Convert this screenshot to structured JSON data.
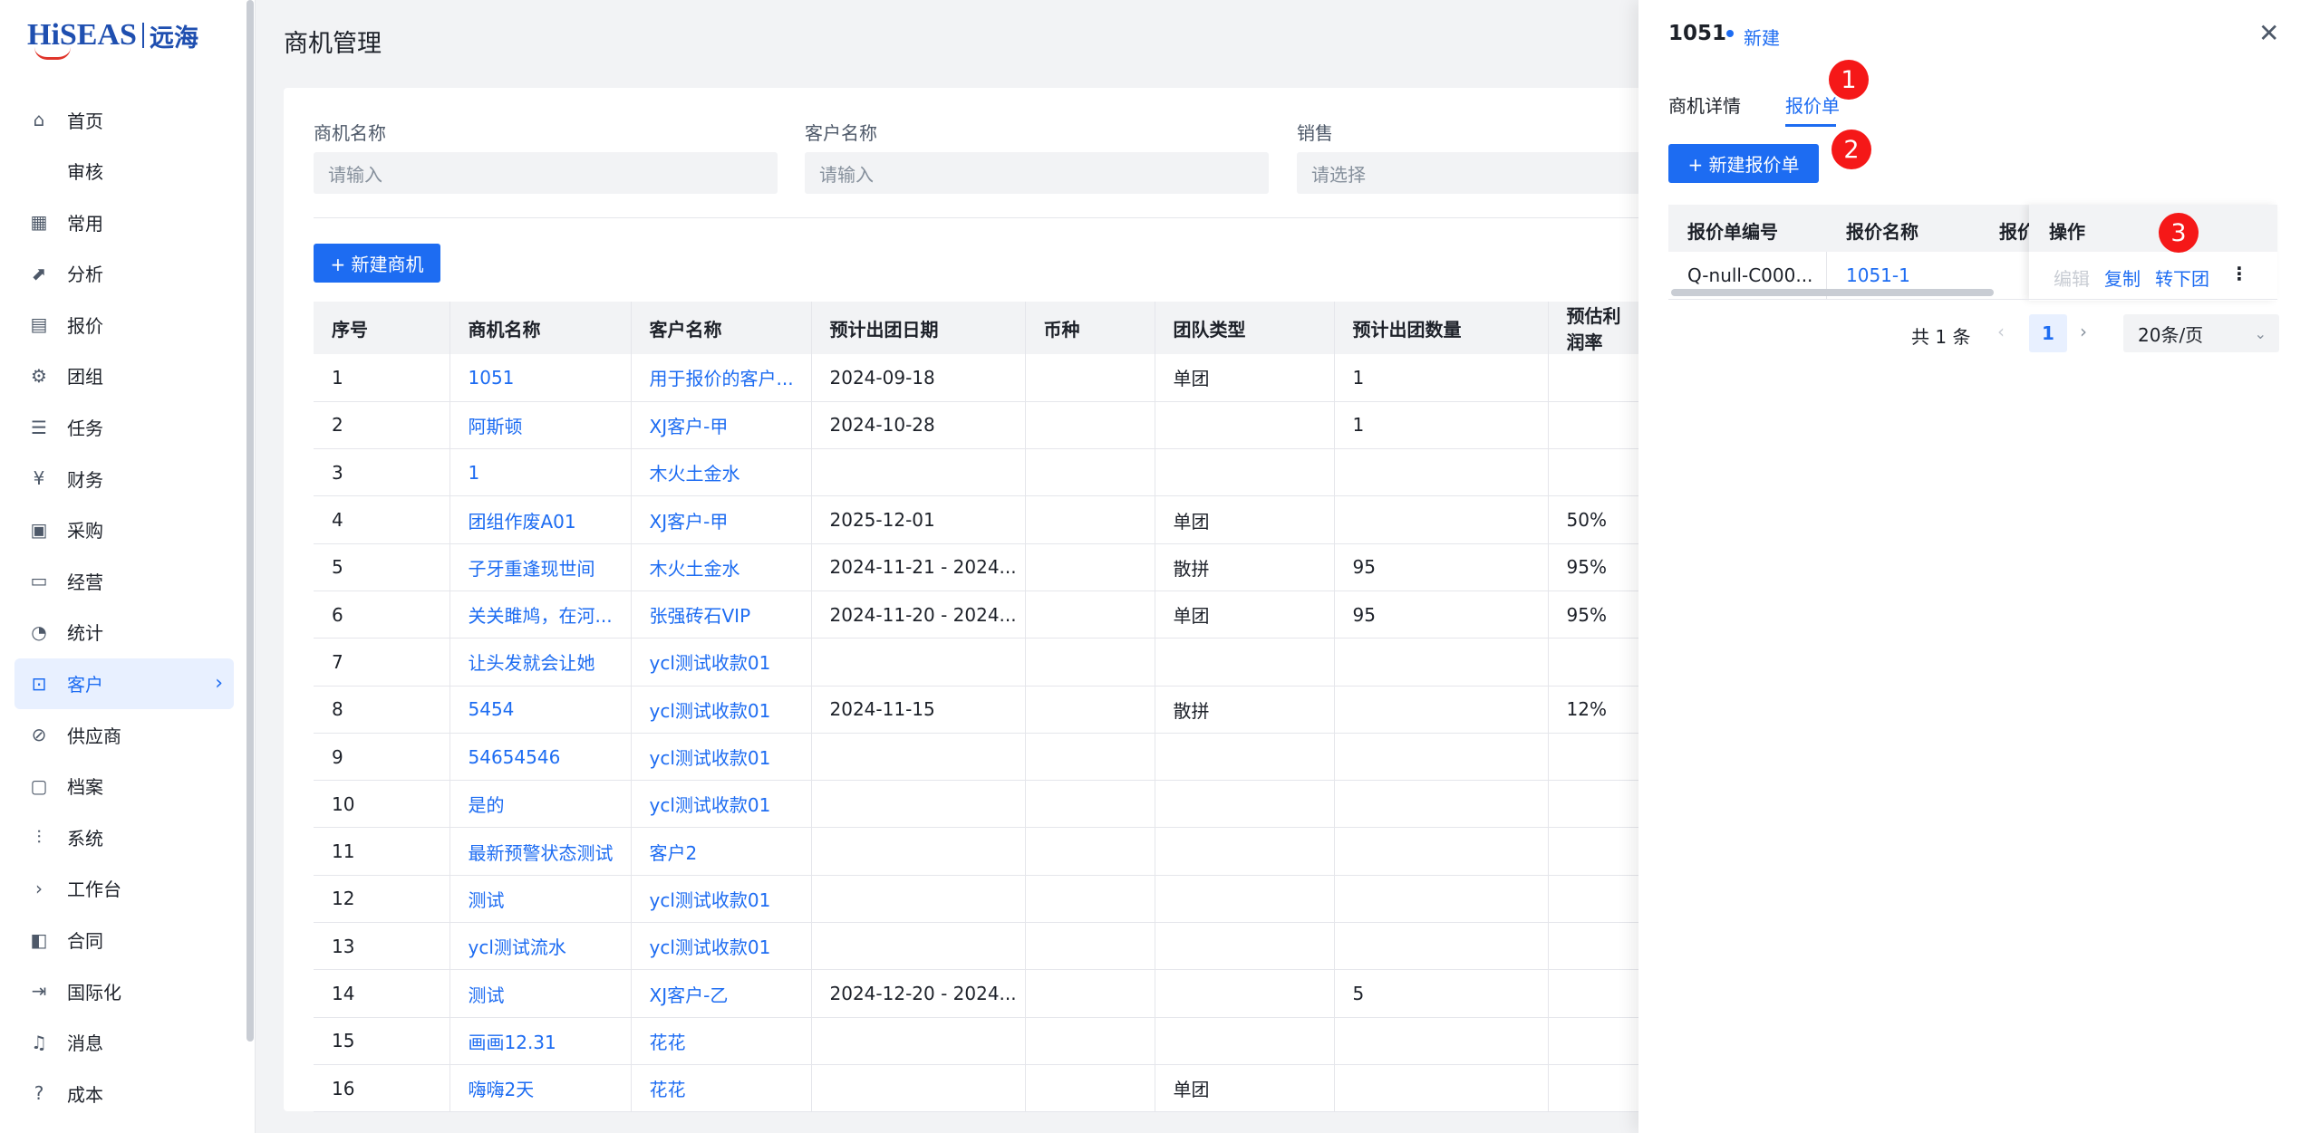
{
  "logo": {
    "brand": "HiSEAS",
    "cn": "远海"
  },
  "sidebar": {
    "items": [
      {
        "label": "首页",
        "icon": "home-icon"
      },
      {
        "label": "审核",
        "icon": ""
      },
      {
        "label": "常用",
        "icon": "grid-icon"
      },
      {
        "label": "分析",
        "icon": "chart-icon"
      },
      {
        "label": "报价",
        "icon": "document-icon"
      },
      {
        "label": "团组",
        "icon": "group-icon"
      },
      {
        "label": "任务",
        "icon": "task-icon"
      },
      {
        "label": "财务",
        "icon": "yen-icon"
      },
      {
        "label": "采购",
        "icon": "cart-icon"
      },
      {
        "label": "经营",
        "icon": "monitor-icon"
      },
      {
        "label": "统计",
        "icon": "pie-icon"
      },
      {
        "label": "客户",
        "icon": "customer-icon"
      },
      {
        "label": "供应商",
        "icon": "supplier-icon"
      },
      {
        "label": "档案",
        "icon": "folder-icon"
      },
      {
        "label": "系统",
        "icon": "settings-icon"
      },
      {
        "label": "工作台",
        "icon": "chevron-right-icon"
      },
      {
        "label": "合同",
        "icon": "contract-icon"
      },
      {
        "label": "国际化",
        "icon": "export-icon"
      },
      {
        "label": "消息",
        "icon": "bell-icon"
      },
      {
        "label": "成本",
        "icon": "cost-icon"
      }
    ],
    "active_index": 11
  },
  "page": {
    "title": "商机管理"
  },
  "filters": {
    "opportunity_name": {
      "label": "商机名称",
      "placeholder": "请输入"
    },
    "customer_name": {
      "label": "客户名称",
      "placeholder": "请输入"
    },
    "sales": {
      "label": "销售",
      "placeholder": "请选择"
    }
  },
  "toolbar": {
    "new_opportunity": "+ 新建商机"
  },
  "table": {
    "headers": [
      "序号",
      "商机名称",
      "客户名称",
      "预计出团日期",
      "币种",
      "团队类型",
      "预计出团数量",
      "预估利润率"
    ],
    "rows": [
      [
        "1",
        "1051",
        "用于报价的客户...",
        "2024-09-18",
        "",
        "单团",
        "1",
        ""
      ],
      [
        "2",
        "阿斯顿",
        "XJ客户-甲",
        "2024-10-28",
        "",
        "",
        "1",
        ""
      ],
      [
        "3",
        "1",
        "木火土金水",
        "",
        "",
        "",
        "",
        ""
      ],
      [
        "4",
        "团组作废A01",
        "XJ客户-甲",
        "2025-12-01",
        "",
        "单团",
        "",
        "50%"
      ],
      [
        "5",
        "子牙重逢现世间",
        "木火土金水",
        "2024-11-21 - 2024...",
        "",
        "散拼",
        "95",
        "95%"
      ],
      [
        "6",
        "关关雎鸠，在河...",
        "张强砖石VIP",
        "2024-11-20 - 2024...",
        "",
        "单团",
        "95",
        "95%"
      ],
      [
        "7",
        "让头发就会让她",
        "ycl测试收款01",
        "",
        "",
        "",
        "",
        ""
      ],
      [
        "8",
        "5454",
        "ycl测试收款01",
        "2024-11-15",
        "",
        "散拼",
        "",
        "12%"
      ],
      [
        "9",
        "54654546",
        "ycl测试收款01",
        "",
        "",
        "",
        "",
        ""
      ],
      [
        "10",
        "是的",
        "ycl测试收款01",
        "",
        "",
        "",
        "",
        ""
      ],
      [
        "11",
        "最新预警状态测试",
        "客户2",
        "",
        "",
        "",
        "",
        ""
      ],
      [
        "12",
        "测试",
        "ycl测试收款01",
        "",
        "",
        "",
        "",
        ""
      ],
      [
        "13",
        "ycl测试流水",
        "ycl测试收款01",
        "",
        "",
        "",
        "",
        ""
      ],
      [
        "14",
        "测试",
        "XJ客户-乙",
        "2024-12-20 - 2024...",
        "",
        "",
        "5",
        ""
      ],
      [
        "15",
        "画画12.31",
        "花花",
        "",
        "",
        "",
        "",
        ""
      ],
      [
        "16",
        "嗨嗨2天",
        "花花",
        "",
        "",
        "单团",
        "",
        ""
      ]
    ]
  },
  "drawer": {
    "id": "1051",
    "status": "新建",
    "tabs": [
      "商机详情",
      "报价单"
    ],
    "active_tab": 1,
    "new_quote": "+ 新建报价单",
    "quote_headers": [
      "报价单编号",
      "报价名称",
      "报价",
      "操作"
    ],
    "quote_rows": [
      {
        "no": "Q-null-C000...",
        "name": "1051-1",
        "edit": "编辑",
        "copy": "复制",
        "to_group": "转下团",
        "more": "⋮"
      }
    ],
    "pager": {
      "total": "共 1 条",
      "page": "1",
      "size": "20条/页"
    },
    "badges": [
      "1",
      "2",
      "3"
    ]
  }
}
